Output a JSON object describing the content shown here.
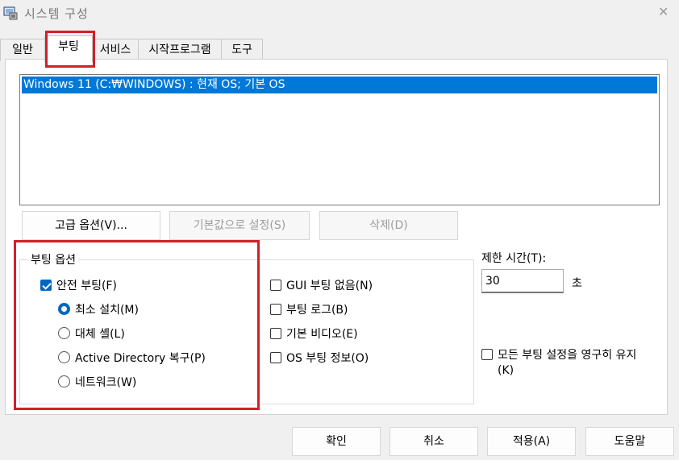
{
  "window": {
    "title": "시스템 구성",
    "close_glyph": "✕"
  },
  "tabs": [
    {
      "label": "일반"
    },
    {
      "label": "부팅"
    },
    {
      "label": "서비스"
    },
    {
      "label": "시작프로그램"
    },
    {
      "label": "도구"
    }
  ],
  "active_tab": "부팅",
  "os_list": {
    "items": [
      "Windows 11 (C:₩WINDOWS) : 현재 OS; 기본 OS"
    ]
  },
  "list_buttons": {
    "advanced": "고급 옵션(V)...",
    "set_default": "기본값으로 설정(S)",
    "delete": "삭제(D)"
  },
  "boot_options": {
    "title": "부팅 옵션",
    "safe_boot": {
      "label": "안전 부팅(F)",
      "checked": true
    },
    "radios": [
      {
        "label": "최소 설치(M)",
        "selected": true
      },
      {
        "label": "대체 셸(L)",
        "selected": false
      },
      {
        "label": "Active Directory 복구(P)",
        "selected": false
      },
      {
        "label": "네트워크(W)",
        "selected": false
      }
    ],
    "checks": [
      {
        "label": "GUI 부팅 없음(N)",
        "checked": false
      },
      {
        "label": "부팅 로그(B)",
        "checked": false
      },
      {
        "label": "기본 비디오(E)",
        "checked": false
      },
      {
        "label": "OS 부팅 정보(O)",
        "checked": false
      }
    ]
  },
  "timeout": {
    "label": "제한 시간(T):",
    "value": "30",
    "unit": "초"
  },
  "persist": {
    "label": "모든 부팅 설정을 영구히 유지",
    "suffix": "(K)",
    "checked": false
  },
  "footer": {
    "ok": "확인",
    "cancel": "취소",
    "apply": "적용(A)",
    "help": "도움말"
  },
  "colors": {
    "accent": "#0078d7",
    "check": "#0067c0",
    "highlight_box": "#d0202a"
  },
  "icons": {
    "app": "msconfig-icon",
    "close": "close-icon"
  }
}
